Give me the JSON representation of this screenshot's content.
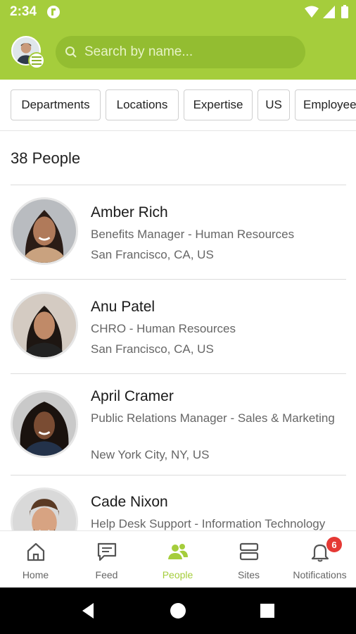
{
  "status_bar": {
    "time": "2:34"
  },
  "header": {
    "search": {
      "placeholder": "Search by name...",
      "value": ""
    },
    "accent_color": "#a5cd3c"
  },
  "filters": [
    {
      "label": "Departments"
    },
    {
      "label": "Locations"
    },
    {
      "label": "Expertise"
    },
    {
      "label": "US"
    },
    {
      "label": "Employee"
    }
  ],
  "people_count": "38 People",
  "people": [
    {
      "name": "Amber Rich",
      "role": "Benefits Manager - Human Resources",
      "location": "San Francisco, CA, US"
    },
    {
      "name": "Anu Patel",
      "role": "CHRO - Human Resources",
      "location": "San Francisco, CA, US"
    },
    {
      "name": "April Cramer",
      "role": "Public Relations Manager - Sales & Marketing",
      "location": "New York City, NY, US"
    },
    {
      "name": "Cade Nixon",
      "role": "Help Desk Support - Information Technology",
      "location": ""
    }
  ],
  "bottom_nav": [
    {
      "label": "Home",
      "icon": "home-icon",
      "active": false
    },
    {
      "label": "Feed",
      "icon": "feed-icon",
      "active": false
    },
    {
      "label": "People",
      "icon": "people-icon",
      "active": true
    },
    {
      "label": "Sites",
      "icon": "sites-icon",
      "active": false
    },
    {
      "label": "Notifications",
      "icon": "bell-icon",
      "active": false,
      "badge": "6"
    }
  ]
}
